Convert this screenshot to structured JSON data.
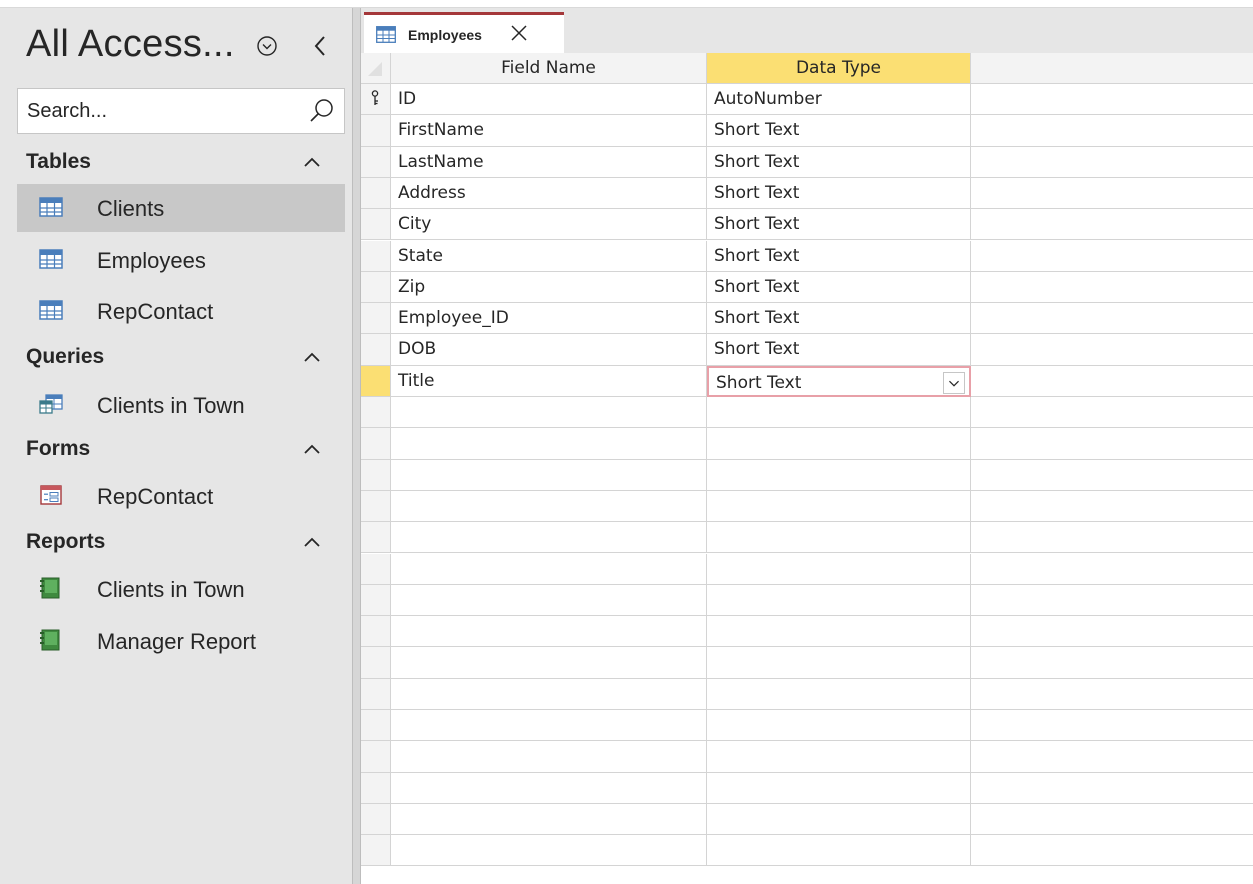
{
  "nav": {
    "title": "All Access...",
    "search_placeholder": "Search...",
    "groups": [
      {
        "label": "Tables",
        "items": [
          "Clients",
          "Employees",
          "RepContact"
        ]
      },
      {
        "label": "Queries",
        "items": [
          "Clients in Town"
        ]
      },
      {
        "label": "Forms",
        "items": [
          "RepContact"
        ]
      },
      {
        "label": "Reports",
        "items": [
          "Clients in Town",
          "Manager Report"
        ]
      }
    ]
  },
  "tab": {
    "label": "Employees"
  },
  "grid": {
    "headers": {
      "field_name": "Field Name",
      "data_type": "Data Type"
    },
    "rows": [
      {
        "field": "ID",
        "type": "AutoNumber"
      },
      {
        "field": "FirstName",
        "type": "Short Text"
      },
      {
        "field": "LastName",
        "type": "Short Text"
      },
      {
        "field": "Address",
        "type": "Short Text"
      },
      {
        "field": "City",
        "type": "Short Text"
      },
      {
        "field": "State",
        "type": "Short Text"
      },
      {
        "field": "Zip",
        "type": "Short Text"
      },
      {
        "field": "Employee_ID",
        "type": "Short Text"
      },
      {
        "field": "DOB",
        "type": "Short Text"
      },
      {
        "field": "Title",
        "type": "Short Text"
      }
    ]
  },
  "icons": {
    "nav_menu": "circle-chevron-down-icon",
    "nav_collapse": "chevron-left-icon",
    "search": "search-icon",
    "group_collapse": "chevron-up-icon",
    "table": "table-icon",
    "query": "query-icon",
    "form": "form-icon",
    "report": "report-icon",
    "close": "close-icon",
    "primary_key": "key-icon",
    "dropdown": "chevron-down-icon"
  },
  "colors": {
    "tab_accent": "#a4373a",
    "current_header": "#fbdf73",
    "nav_background": "#e6e6e6",
    "selected_item": "#c8c8c8"
  }
}
